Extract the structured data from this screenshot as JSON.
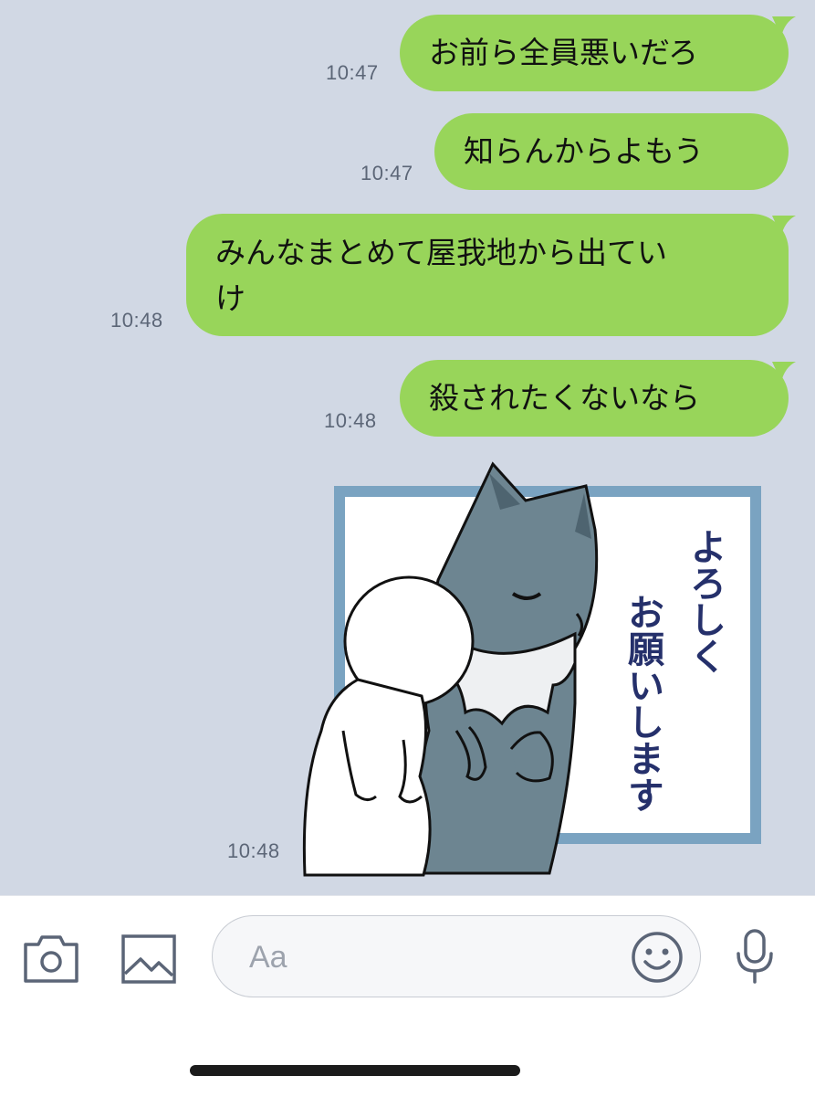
{
  "messages": [
    {
      "text": "お前ら全員悪いだろ",
      "time": "10:47"
    },
    {
      "text": "知らんからよもう",
      "time": "10:47"
    },
    {
      "text_line1": "みんなまとめて屋我地から出ていけ",
      "text_line1a": "みんなまとめて屋我地から出てい",
      "text_line2": "け",
      "time": "10:48"
    },
    {
      "text": "殺されたくないなら",
      "time": "10:48"
    }
  ],
  "sticker": {
    "text": "よろしくお願いします",
    "col1": "よろしく",
    "col2": "お願いします",
    "time": "10:48"
  },
  "input": {
    "placeholder": "Aa",
    "icons": [
      "camera-icon",
      "image-icon",
      "emoji-icon",
      "microphone-icon"
    ]
  },
  "colors": {
    "chat_background": "#d1d8e4",
    "sent_bubble": "#98d55a",
    "icon": "#5b6577"
  }
}
